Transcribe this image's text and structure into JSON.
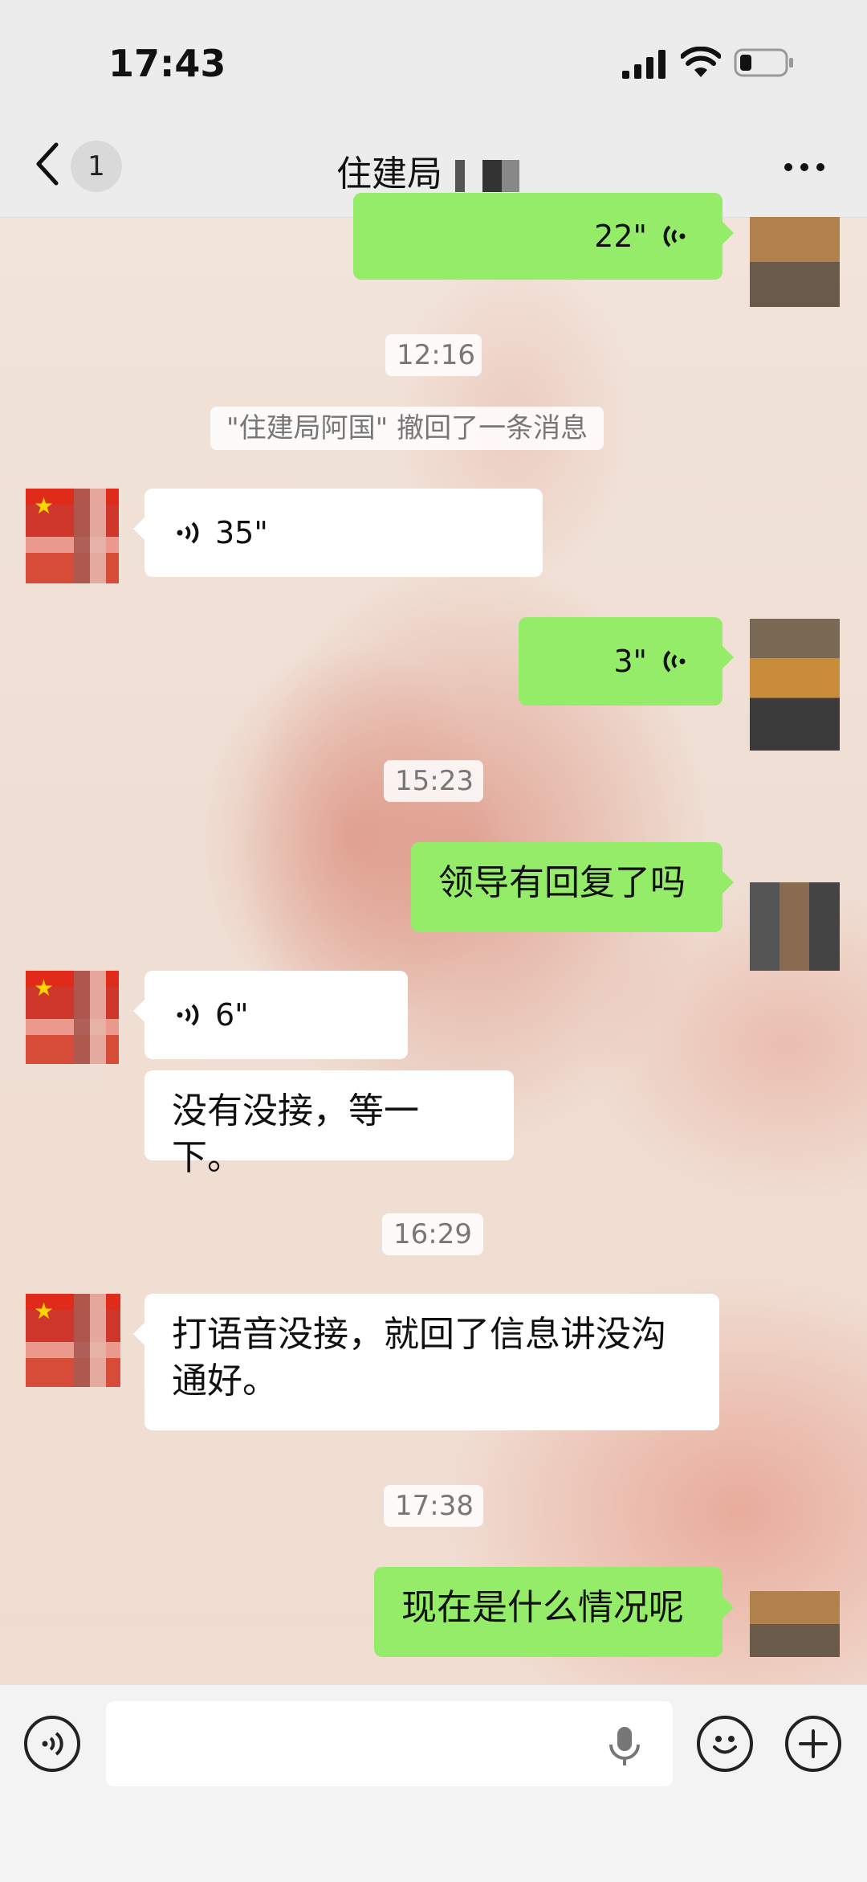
{
  "status_bar": {
    "time": "17:43"
  },
  "nav": {
    "unread_count": "1",
    "title": "住建局"
  },
  "messages": {
    "m1_duration": "22\"",
    "t1": "12:16",
    "recall_notice": "\"住建局阿国\" 撤回了一条消息",
    "m2_duration": "35\"",
    "m3_duration": "3\"",
    "t2": "15:23",
    "m4_text": "领导有回复了吗",
    "m5_duration": "6\"",
    "m6_text": "没有没接，等一下。",
    "t3": "16:29",
    "m7_line1": "打语音没接，就回了信息讲没沟",
    "m7_line2": "通好。",
    "t4": "17:38",
    "m8_text": "现在是什么情况呢"
  },
  "input_bar": {
    "placeholder": ""
  },
  "colors": {
    "outgoing_bubble": "#95ec69",
    "incoming_bubble": "#ffffff",
    "bar_background": "#ececec"
  },
  "icons": {
    "back": "chevron-left-icon",
    "more": "more-horizontal-icon",
    "voice_toggle": "voice-icon",
    "mic": "mic-icon",
    "emoji": "emoji-icon",
    "plus": "plus-icon"
  }
}
